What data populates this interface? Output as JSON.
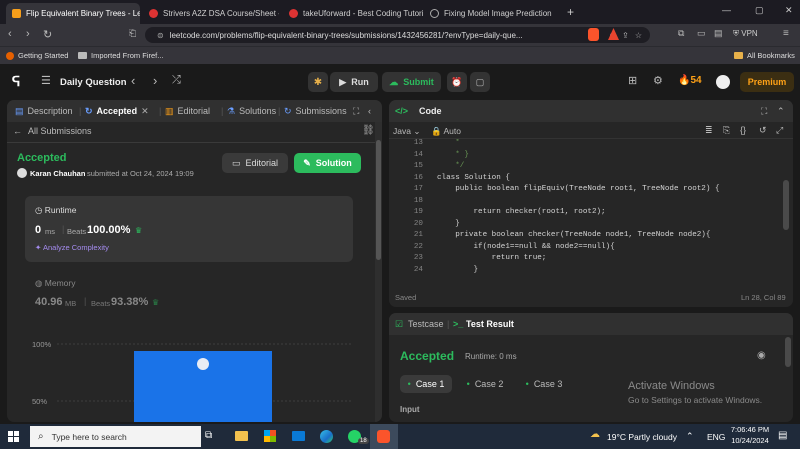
{
  "browser": {
    "tabs": [
      {
        "title": "Flip Equivalent Binary Trees - Le",
        "color": "#f89f1b",
        "active": true
      },
      {
        "title": "Strivers A2Z DSA Course/Sheet - Cr",
        "color": "#e44"
      },
      {
        "title": "takeUforward - Best Coding Tutoria",
        "color": "#e44"
      },
      {
        "title": "Fixing Model Image Prediction",
        "color": "#888"
      }
    ],
    "new_tab": "+",
    "url": "leetcode.com/problems/flip-equivalent-binary-trees/submissions/1432456281/?envType=daily-que...",
    "vpn": "VPN",
    "bookmarks": [
      "Getting Started",
      "Imported From Firef..."
    ],
    "all_bookmarks": "All Bookmarks",
    "window_controls": [
      "—",
      "▢",
      "✕"
    ]
  },
  "leetcode": {
    "header": {
      "problem_list": "Daily Question",
      "run": "Run",
      "submit": "Submit",
      "streak": "54",
      "premium": "Premium"
    },
    "left": {
      "tabs": [
        "Description",
        "Accepted",
        "Editorial",
        "Solutions",
        "Submissions"
      ],
      "back": "All Submissions",
      "status": "Accepted",
      "user": "Karan Chauhan",
      "submitted": "submitted at Oct 24, 2024 19:09",
      "editorial_btn": "Editorial",
      "solution_btn": "Solution",
      "runtime": {
        "label": "Runtime",
        "value": "0",
        "unit": "ms",
        "beats_label": "Beats",
        "beats": "100.00%",
        "analyze": "Analyze Complexity"
      },
      "memory": {
        "label": "Memory",
        "value": "40.96",
        "unit": "MB",
        "beats_label": "Beats",
        "beats": "93.38%"
      },
      "chart_data": {
        "type": "bar",
        "ytick_labels": [
          "100%",
          "50%"
        ],
        "bar_color": "#1a73e8"
      }
    },
    "code": {
      "title": "Code",
      "lang": "Java",
      "mode": "Auto",
      "lines": [
        {
          "n": "13",
          "t": "    *"
        },
        {
          "n": "14",
          "t": "    * }"
        },
        {
          "n": "15",
          "t": "    */"
        },
        {
          "n": "16",
          "t": "class Solution {"
        },
        {
          "n": "17",
          "t": "    public boolean flipEquiv(TreeNode root1, TreeNode root2) {"
        },
        {
          "n": "18",
          "t": ""
        },
        {
          "n": "19",
          "t": "        return checker(root1, root2);"
        },
        {
          "n": "20",
          "t": "    }"
        },
        {
          "n": "21",
          "t": "    private boolean checker(TreeNode node1, TreeNode node2){"
        },
        {
          "n": "22",
          "t": "        if(node1==null && node2==null){"
        },
        {
          "n": "23",
          "t": "            return true;"
        },
        {
          "n": "24",
          "t": "        }"
        }
      ],
      "saved": "Saved",
      "position": "Ln 28, Col 89"
    },
    "result": {
      "tab_testcase": "Testcase",
      "tab_result": "Test Result",
      "status": "Accepted",
      "runtime": "Runtime: 0 ms",
      "cases": [
        "Case 1",
        "Case 2",
        "Case 3"
      ],
      "input_label": "Input",
      "watermark_title": "Activate Windows",
      "watermark_sub": "Go to Settings to activate Windows."
    }
  },
  "taskbar": {
    "search": "Type here to search",
    "weather": "19°C  Partly cloudy",
    "lang": "ENG",
    "time": "7:06:46 PM",
    "date": "10/24/2024",
    "badge": "18"
  }
}
